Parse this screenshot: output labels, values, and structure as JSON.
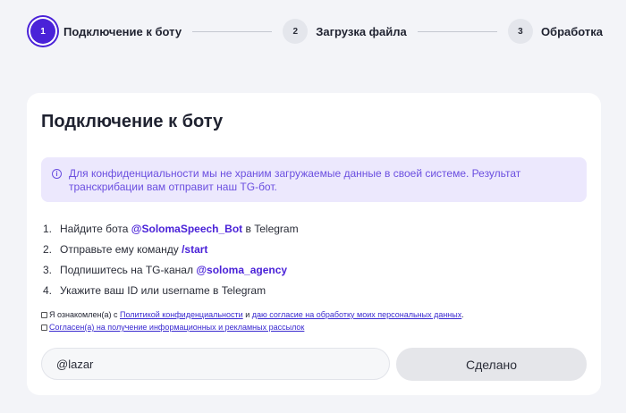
{
  "stepper": {
    "steps": [
      {
        "number": "1",
        "label": "Подключение к боту"
      },
      {
        "number": "2",
        "label": "Загрузка файла"
      },
      {
        "number": "3",
        "label": "Обработка"
      }
    ]
  },
  "card": {
    "title": "Подключение к боту",
    "notice": "Для конфиденциальности мы не храним загружаемые данные в своей системе. Результат транскрибации вам отправит наш TG-бот.",
    "steps": [
      {
        "num": "1.",
        "before": "Найдите бота ",
        "highlight": "@SolomaSpeech_Bot",
        "after": " в Telegram"
      },
      {
        "num": "2.",
        "before": "Отправьте ему команду ",
        "highlight": "/start",
        "after": ""
      },
      {
        "num": "3.",
        "before": "Подпишитесь на TG-канал ",
        "highlight": "@soloma_agency",
        "after": ""
      },
      {
        "num": "4.",
        "before": "Укажите ваш ID или username в Telegram",
        "highlight": "",
        "after": ""
      }
    ],
    "consent1": {
      "prefix": "Я ознакомлен(а) с ",
      "link1": "Политикой конфиденциальности",
      "middle": " и ",
      "link2": "даю согласие на обработку моих персональных данных",
      "suffix": "."
    },
    "consent2": {
      "link": "Согласен(а) на получение информационных и рекламных рассылок"
    },
    "input_value": "@lazar",
    "submit_label": "Сделано"
  },
  "colors": {
    "accent": "#4a22d8",
    "notice_bg": "#ece8fd",
    "notice_text": "#6b4fe0"
  }
}
